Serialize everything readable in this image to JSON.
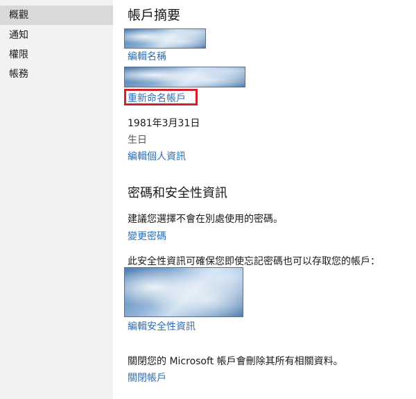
{
  "sidebar": {
    "items": [
      {
        "label": "概觀",
        "selected": true
      },
      {
        "label": "通知",
        "selected": false
      },
      {
        "label": "權限",
        "selected": false
      },
      {
        "label": "帳務",
        "selected": false
      }
    ]
  },
  "summary": {
    "title": "帳戶摘要",
    "edit_name_link": "編輯名稱",
    "rename_account_link": "重新命名帳戶",
    "birthdate": "1981年3月31日",
    "birthdate_label": "生日",
    "edit_personal_info_link": "編輯個人資訊"
  },
  "security": {
    "title": "密碼和安全性資訊",
    "password_tip": "建議您選擇不會在別處使用的密碼。",
    "change_password_link": "變更密碼",
    "security_info_text": "此安全性資訊可確保您即使忘記密碼也可以存取您的帳戶：",
    "edit_security_info_link": "編輯安全性資訊"
  },
  "close_account": {
    "text": "關閉您的 Microsoft 帳戶會刪除其所有相關資料。",
    "link": "關閉帳戶"
  },
  "colors": {
    "link": "#2e6db3",
    "highlight": "#d01f26",
    "sidebar_bg": "#f2f2f2",
    "sidebar_selected": "#d9d9d9"
  }
}
